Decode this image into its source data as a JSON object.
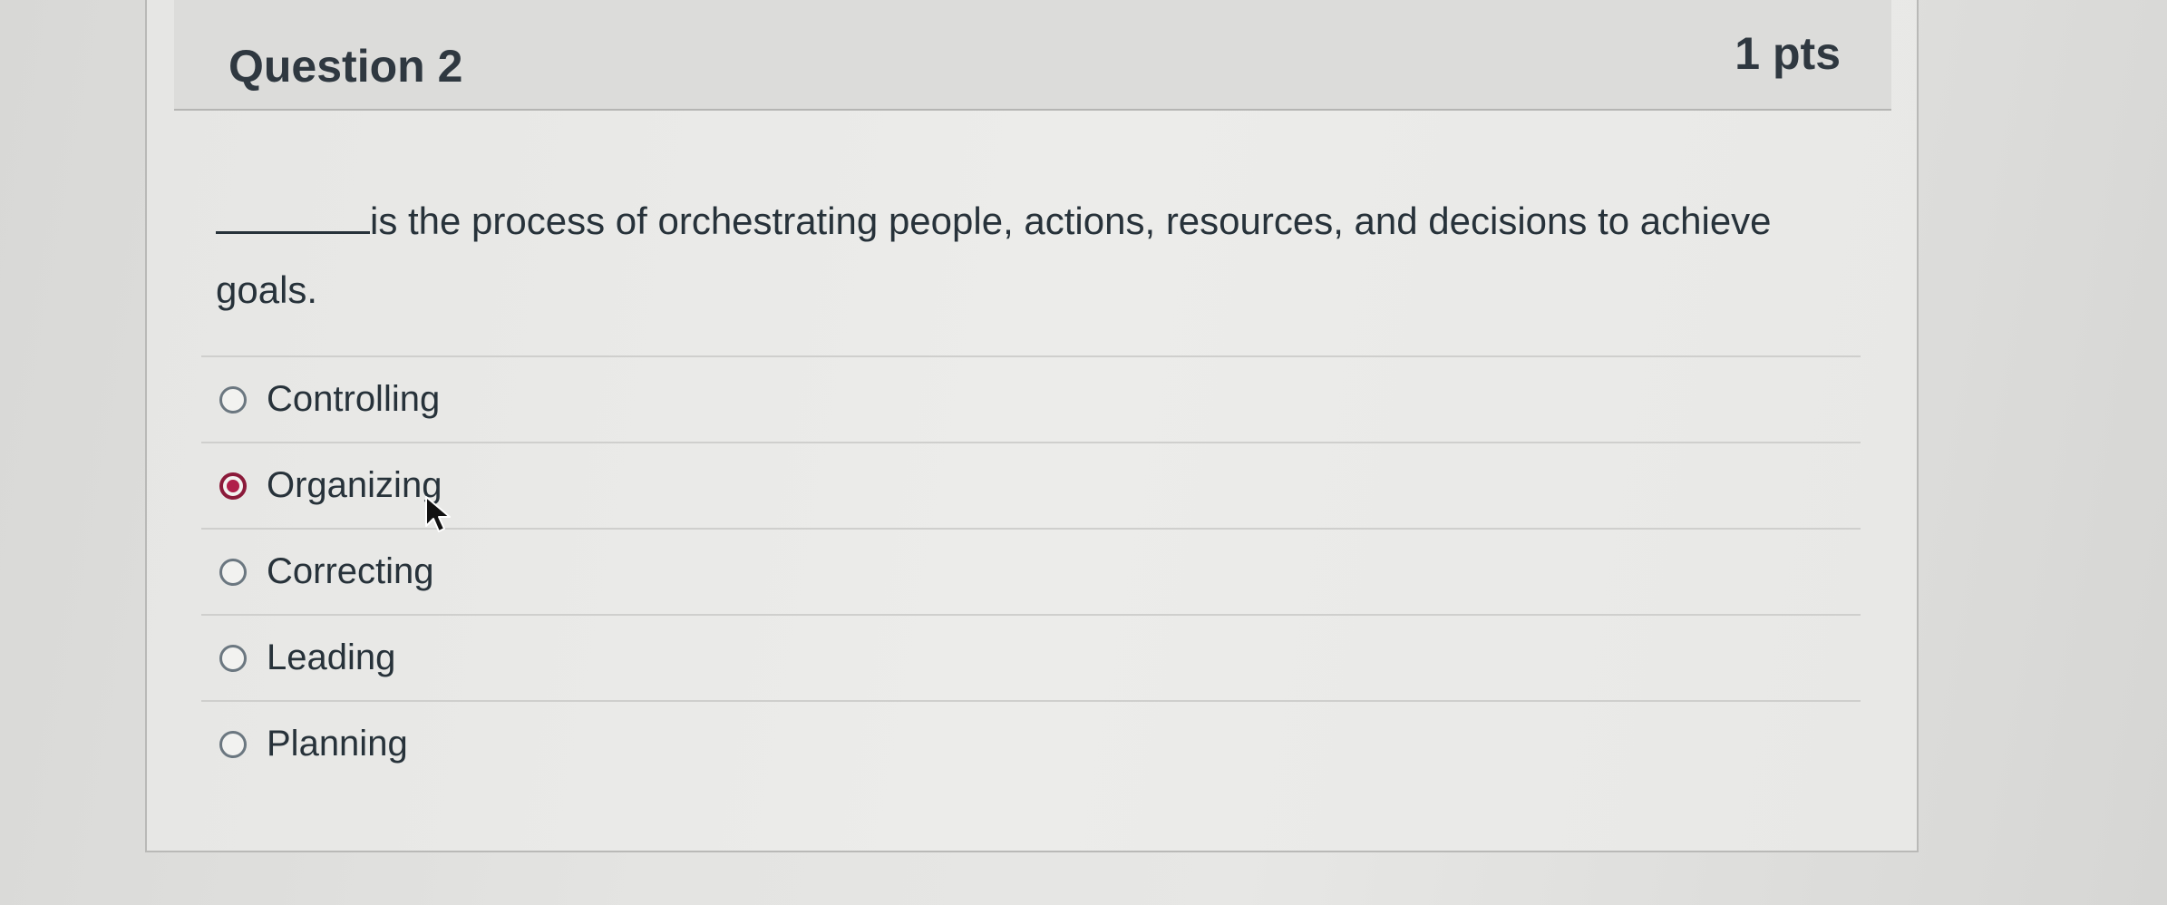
{
  "question": {
    "title": "Question 2",
    "points": "1 pts",
    "text": "is the process of orchestrating people, actions, resources, and decisions to achieve goals."
  },
  "answers": [
    {
      "label": "Controlling",
      "selected": false
    },
    {
      "label": "Organizing",
      "selected": true
    },
    {
      "label": "Correcting",
      "selected": false
    },
    {
      "label": "Leading",
      "selected": false
    },
    {
      "label": "Planning",
      "selected": false
    }
  ],
  "colors": {
    "selected_radio": "#b01e4a",
    "header_bg": "#dcdcda"
  },
  "icons": {
    "cursor": "mouse-pointer-icon"
  }
}
